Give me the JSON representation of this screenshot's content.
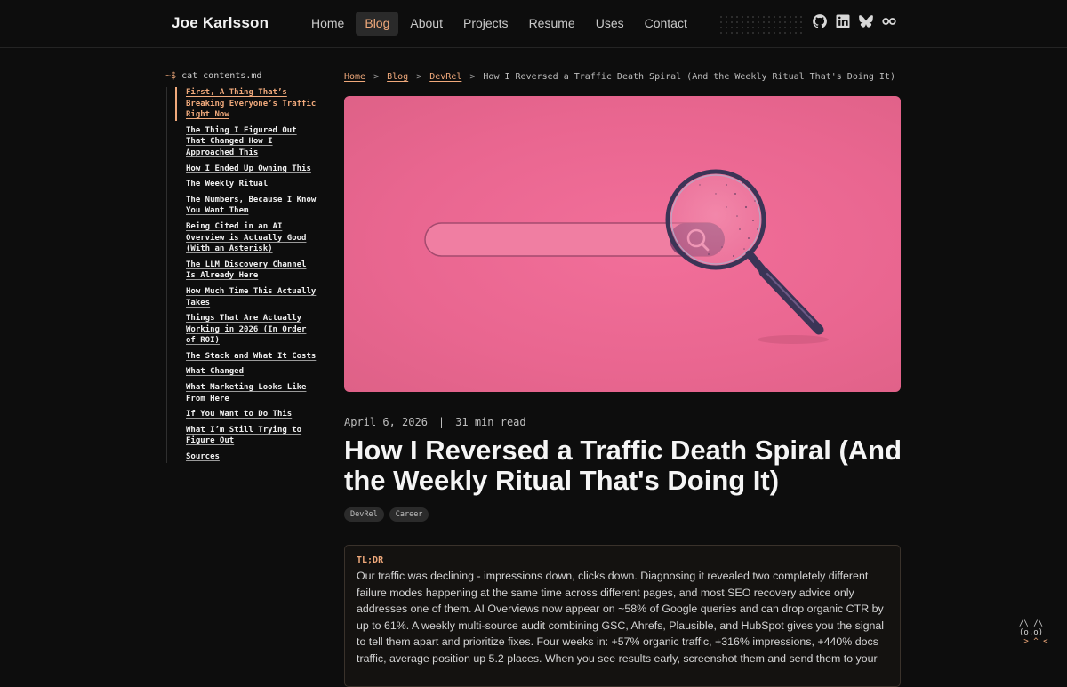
{
  "header": {
    "brand": "Joe Karlsson",
    "nav": [
      {
        "label": "Home",
        "active": false
      },
      {
        "label": "Blog",
        "active": true
      },
      {
        "label": "About",
        "active": false
      },
      {
        "label": "Projects",
        "active": false
      },
      {
        "label": "Resume",
        "active": false
      },
      {
        "label": "Uses",
        "active": false
      },
      {
        "label": "Contact",
        "active": false
      }
    ],
    "socials": [
      "github-icon",
      "linkedin-icon",
      "bluesky-icon",
      "fediverse-icon"
    ]
  },
  "toc": {
    "prompt": "~$",
    "command": "cat contents.md",
    "items": [
      {
        "label": "First, A Thing That’s Breaking Everyone’s Traffic Right Now",
        "active": true
      },
      {
        "label": "The Thing I Figured Out That Changed How I Approached This",
        "active": false
      },
      {
        "label": "How I Ended Up Owning This",
        "active": false
      },
      {
        "label": "The Weekly Ritual",
        "active": false
      },
      {
        "label": "The Numbers, Because I Know You Want Them",
        "active": false
      },
      {
        "label": "Being Cited in an AI Overview is Actually Good (With an Asterisk)",
        "active": false
      },
      {
        "label": "The LLM Discovery Channel Is Already Here",
        "active": false
      },
      {
        "label": "How Much Time This Actually Takes",
        "active": false
      },
      {
        "label": "Things That Are Actually Working in 2026 (In Order of ROI)",
        "active": false
      },
      {
        "label": "The Stack and What It Costs",
        "active": false
      },
      {
        "label": "What Changed",
        "active": false
      },
      {
        "label": "What Marketing Looks Like From Here",
        "active": false
      },
      {
        "label": "If You Want to Do This",
        "active": false
      },
      {
        "label": "What I’m Still Trying to Figure Out",
        "active": false
      },
      {
        "label": "Sources",
        "active": false
      }
    ]
  },
  "breadcrumb": {
    "home": "Home",
    "blog": "Blog",
    "category": "DevRel",
    "current": "How I Reversed a Traffic Death Spiral (And the Weekly Ritual That's Doing It)",
    "separator": ">"
  },
  "post": {
    "date": "April 6, 2026",
    "meta_separator": "|",
    "read_time": "31 min read",
    "title": "How I Reversed a Traffic Death Spiral (And the Weekly Ritual That's Doing It)",
    "tags": [
      "DevRel",
      "Career"
    ],
    "tldr_label": "TL;DR",
    "tldr_text": "Our traffic was declining - impressions down, clicks down. Diagnosing it revealed two completely different failure modes happening at the same time across different pages, and most SEO recovery advice only addresses one of them. AI Overviews now appear on ~58% of Google queries and can drop organic CTR by up to 61%. A weekly multi-source audit combining GSC, Ahrefs, Plausible, and HubSpot gives you the signal to tell them apart and prioritize fixes. Four weeks in: +57% organic traffic, +316% impressions, +440% docs traffic, average position up 5.2 places. When you see results early, screenshot them and send them to your"
  },
  "mascot": {
    "line1": "/\\_/\\",
    "line2": "(o.o)",
    "line3": " > ^ <"
  },
  "colors": {
    "accent": "#f0a97b",
    "background": "#0d0d0d",
    "hero_pink": "#ec6a93"
  }
}
